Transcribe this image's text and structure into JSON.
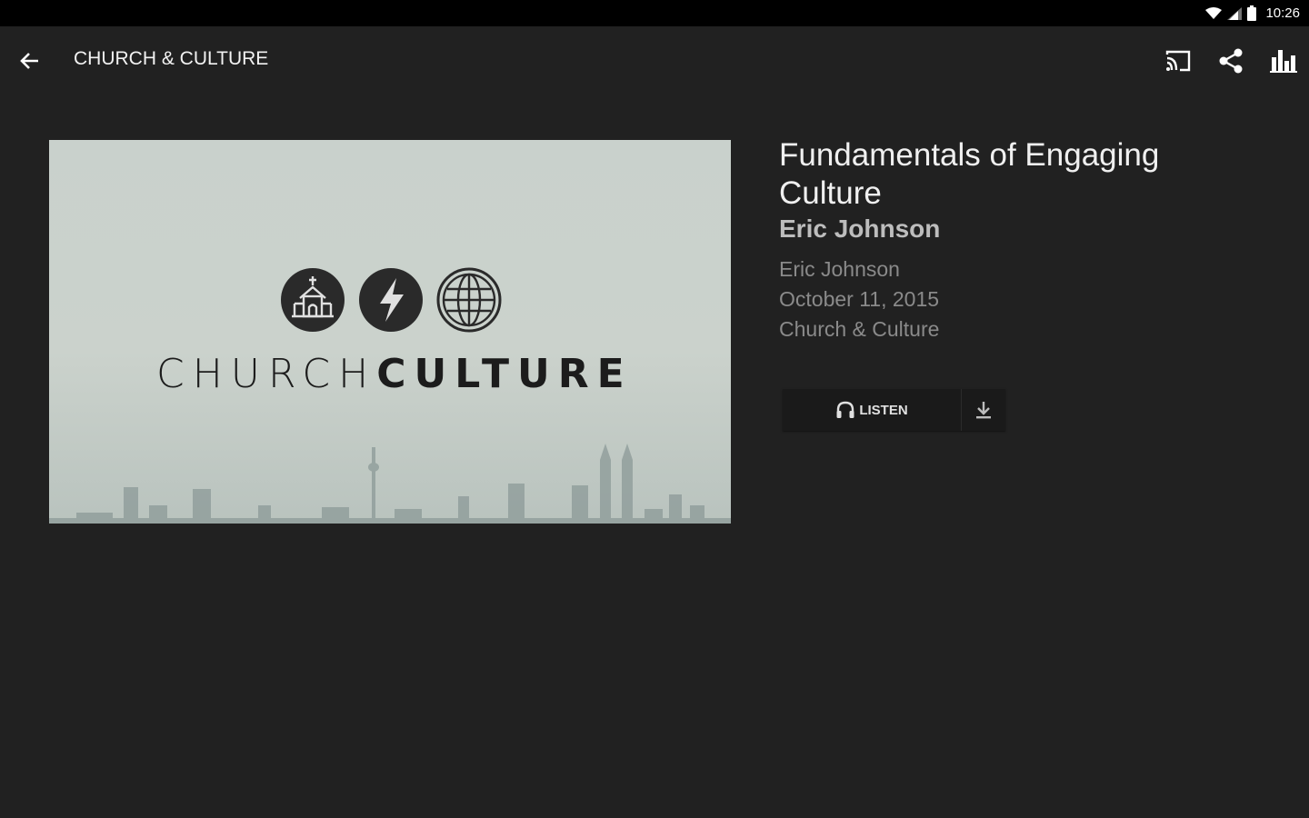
{
  "status_bar": {
    "time": "10:26"
  },
  "app_bar": {
    "title": "CHURCH & CULTURE",
    "back_icon": "arrow-back-icon",
    "actions": [
      "cast-icon",
      "share-icon",
      "bar-chart-icon"
    ]
  },
  "artwork": {
    "wordmark_left": "CHURCH",
    "wordmark_right": "CULTURE"
  },
  "sermon": {
    "title": "Fundamentals of Engaging Culture",
    "speaker": "Eric Johnson",
    "meta_speaker": "Eric Johnson",
    "date": "October 11, 2015",
    "series": "Church & Culture"
  },
  "actions": {
    "listen_label": "LISTEN",
    "listen_icon": "headphones-icon",
    "download_icon": "download-icon"
  },
  "colors": {
    "background": "#212121",
    "status_bar": "#000000",
    "accent_text": "#f0f0f0",
    "muted_text": "#8a8a8a"
  }
}
